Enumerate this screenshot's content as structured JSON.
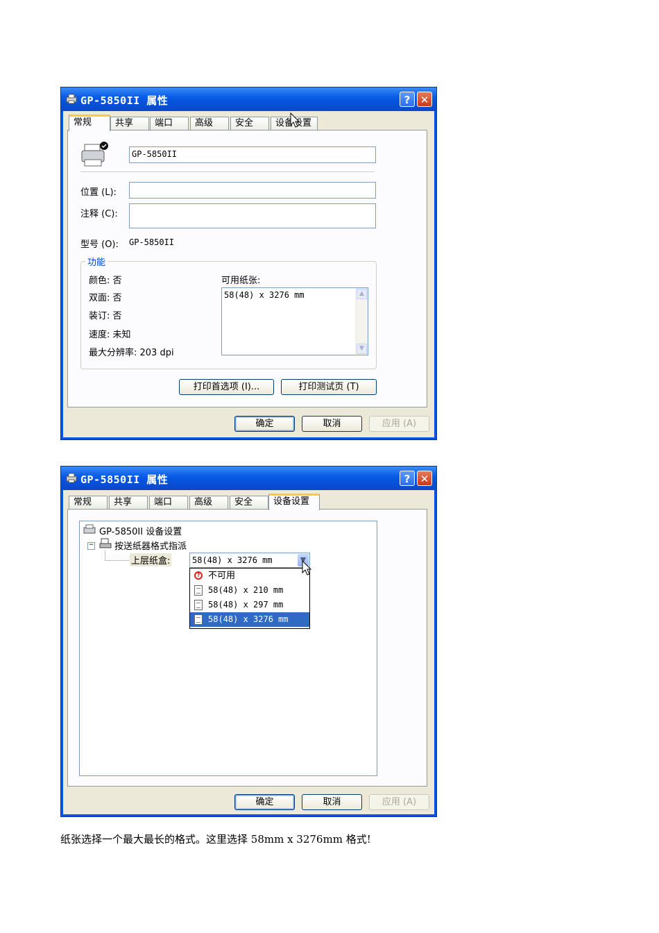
{
  "dialog1": {
    "title": "GP-5850II 属性",
    "tabs": [
      "常规",
      "共享",
      "端口",
      "高级",
      "安全",
      "设备设置"
    ],
    "printer_name_value": "GP-5850II",
    "location_label": "位置 (L):",
    "location_value": "",
    "comment_label": "注释 (C):",
    "comment_value": "",
    "model_label": "型号 (O):",
    "model_value": "GP-5850II",
    "features_group": "功能",
    "color_label": "颜色: 否",
    "duplex_label": "双面: 否",
    "staple_label": "装订: 否",
    "speed_label": "速度: 未知",
    "resolution_label": "最大分辨率: 203 dpi",
    "paper_available_label": "可用纸张:",
    "paper_list": [
      "58(48) x 3276 mm"
    ],
    "print_prefs_button": "打印首选项 (I)...",
    "print_test_button": "打印测试页 (T)",
    "ok_button": "确定",
    "cancel_button": "取消",
    "apply_button": "应用 (A)",
    "help_button": "?",
    "close_button": "✕"
  },
  "dialog2": {
    "title": "GP-5850II 属性",
    "tabs": [
      "常规",
      "共享",
      "端口",
      "高级",
      "安全",
      "设备设置"
    ],
    "tree_root": "GP-5850II 设备设置",
    "tree_node": "按送纸器格式指派",
    "tree_leaf_label": "上层纸盒:",
    "dropdown_value": "58(48) x 3276 mm",
    "dropdown_options": [
      "不可用",
      "58(48) x 210 mm",
      "58(48) x 297 mm",
      "58(48) x 3276 mm"
    ],
    "selected_option_index": 3,
    "ok_button": "确定",
    "cancel_button": "取消",
    "apply_button": "应用 (A)",
    "help_button": "?",
    "close_button": "✕"
  },
  "caption": "纸张选择一个最大最长的格式。这里选择 58mm x 3276mm 格式!",
  "colors": {
    "title_bar": "#0a54e2",
    "dialog_bg": "#ece9d8",
    "active_tab_accent": "#ffc83c",
    "selection": "#316ac5",
    "group_label": "#0046d5"
  }
}
